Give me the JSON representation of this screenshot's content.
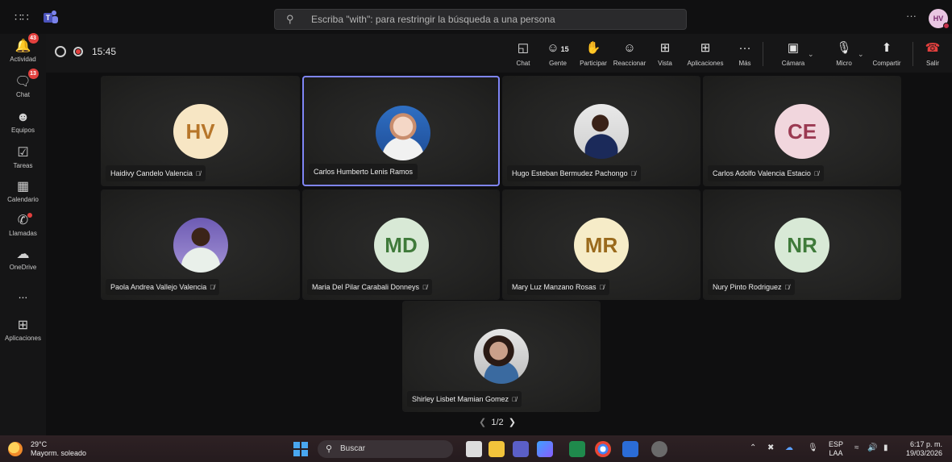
{
  "search": {
    "placeholder": "Escriba \"with\": para restringir la búsqueda a una persona"
  },
  "user": {
    "initials": "HV"
  },
  "rail": [
    {
      "label": "Actividad",
      "badge": "43"
    },
    {
      "label": "Chat",
      "badge": "13"
    },
    {
      "label": "Equipos"
    },
    {
      "label": "Tareas"
    },
    {
      "label": "Calendario"
    },
    {
      "label": "Llamadas"
    },
    {
      "label": "OneDrive"
    },
    {
      "label": "..."
    },
    {
      "label": "Aplicaciones"
    }
  ],
  "meeting": {
    "timer": "15:45",
    "participants_count": "15",
    "toolbar": {
      "chat": "Chat",
      "gente": "Gente",
      "participar": "Participar",
      "reaccionar": "Reaccionar",
      "vista": "Vista",
      "aplicaciones": "Aplicaciones",
      "mas": "Más",
      "camara": "Cámara",
      "micro": "Micro",
      "compartir": "Compartir",
      "salir": "Salir"
    }
  },
  "tiles": [
    {
      "name": "Haidivy Candelo Valencia",
      "initials": "HV",
      "color": "#f7e6c4",
      "text": "#b7762a",
      "muted": true
    },
    {
      "name": "Carlos Humberto Lenis Ramos",
      "photo": true,
      "muted": false,
      "selected": true
    },
    {
      "name": "Hugo Esteban Bermudez Pachongo",
      "photo": true,
      "muted": true
    },
    {
      "name": "Carlos Adolfo Valencia Estacio",
      "initials": "CE",
      "color": "#f1d6dd",
      "text": "#9b3a52",
      "muted": true
    },
    {
      "name": "Paola Andrea Vallejo Valencia",
      "photo": true,
      "muted": true
    },
    {
      "name": "Maria Del Pilar Carabali Donneys",
      "initials": "MD",
      "color": "#d8e9d6",
      "text": "#3f7a3a",
      "muted": true
    },
    {
      "name": "Mary Luz Manzano Rosas",
      "initials": "MR",
      "color": "#f6ecc8",
      "text": "#9a6a1c",
      "muted": true
    },
    {
      "name": "Nury Pinto Rodriguez",
      "initials": "NR",
      "color": "#d8e9d6",
      "text": "#3f7a3a",
      "muted": true
    },
    {
      "name": "Shirley Lisbet Mamian Gomez",
      "photo": true,
      "muted": true
    }
  ],
  "pager": "1/2",
  "taskbar": {
    "temp": "29°C",
    "weather": "Mayorm. soleado",
    "search": "Buscar",
    "lang1": "ESP",
    "lang2": "LAA",
    "time": "6:17 p. m.",
    "date": "19/03/2026"
  }
}
